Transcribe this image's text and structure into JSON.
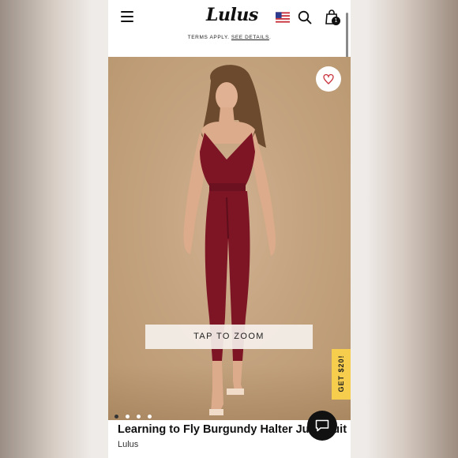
{
  "header": {
    "logo": "Lulus",
    "bag_count": "1"
  },
  "promo": {
    "terms_text": "TERMS APPLY.",
    "details_link": "SEE DETAILS"
  },
  "gallery": {
    "zoom_label": "TAP TO ZOOM",
    "dots": 4,
    "active_dot": 1
  },
  "offer": {
    "label": "GET $20!"
  },
  "product": {
    "title": "Learning to Fly Burgundy Halter Jumpsuit",
    "brand": "Lulus"
  },
  "colors": {
    "accent_yellow": "#f6cd4c",
    "heart_red": "#c8323c",
    "garment_burgundy": "#7d1524"
  }
}
